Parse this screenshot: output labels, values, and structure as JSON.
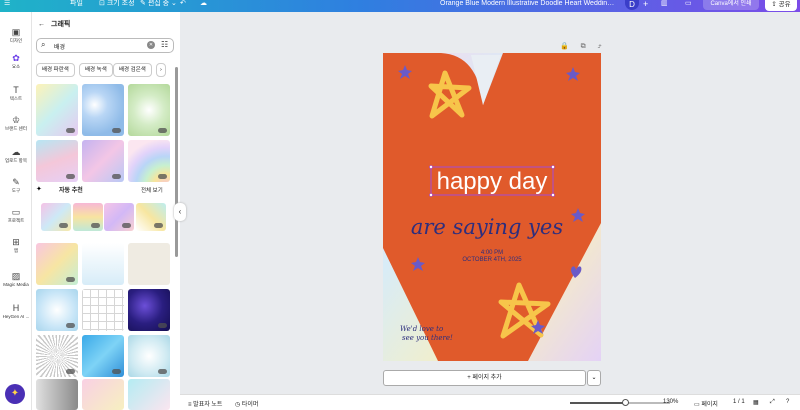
{
  "topbar": {
    "file": "파일",
    "resize": "크기 조정",
    "edit": "편집 중",
    "title": "Orange Blue Modern Illustrative Doodle Heart Wedding Invi...",
    "avatar": "D",
    "plus": "+",
    "upgrade": "Canva에서 인쇄",
    "share": "공유"
  },
  "rail": [
    {
      "label": "디자인",
      "icon": "layout-icon"
    },
    {
      "label": "요소",
      "icon": "shapes-icon",
      "active": true
    },
    {
      "label": "텍스트",
      "icon": "text-icon"
    },
    {
      "label": "브랜드 센터",
      "icon": "brand-icon"
    },
    {
      "label": "업로드 항목",
      "icon": "upload-icon"
    },
    {
      "label": "도구",
      "icon": "draw-icon"
    },
    {
      "label": "프로젝트",
      "icon": "folder-icon"
    },
    {
      "label": "앱",
      "icon": "apps-icon"
    },
    {
      "label": "Magic Media",
      "icon": "magic-media-icon"
    },
    {
      "label": "HeyGen AI ...",
      "icon": "heygen-icon"
    }
  ],
  "panel": {
    "header": "그래픽",
    "search_value": "배경",
    "chips": [
      "배경 파란색",
      "배경 녹색",
      "배경 검은색"
    ],
    "section_title": "자동 추천",
    "see_all": "전체 보기"
  },
  "design": {
    "headline": "happy day",
    "script_line": "are saying yes",
    "time": "4:00 PM",
    "date": "OCTOBER 4TH, 2025",
    "note_line1": "We'd love to",
    "note_line2": "see you there!",
    "colors": {
      "orange": "#e05a2b",
      "navy": "#2d2e7e",
      "yellow": "#f7c54a",
      "selection": "#a44bd6"
    }
  },
  "page_tools": "🔒 ⧉ ⤴",
  "add_page": "+ 페이지 추가",
  "footer": {
    "notes": "발표자 노트",
    "timer": "타이머",
    "zoom": "130%",
    "zoom_level": 0.55,
    "pages": "페이지",
    "page_count": "1 / 1"
  }
}
